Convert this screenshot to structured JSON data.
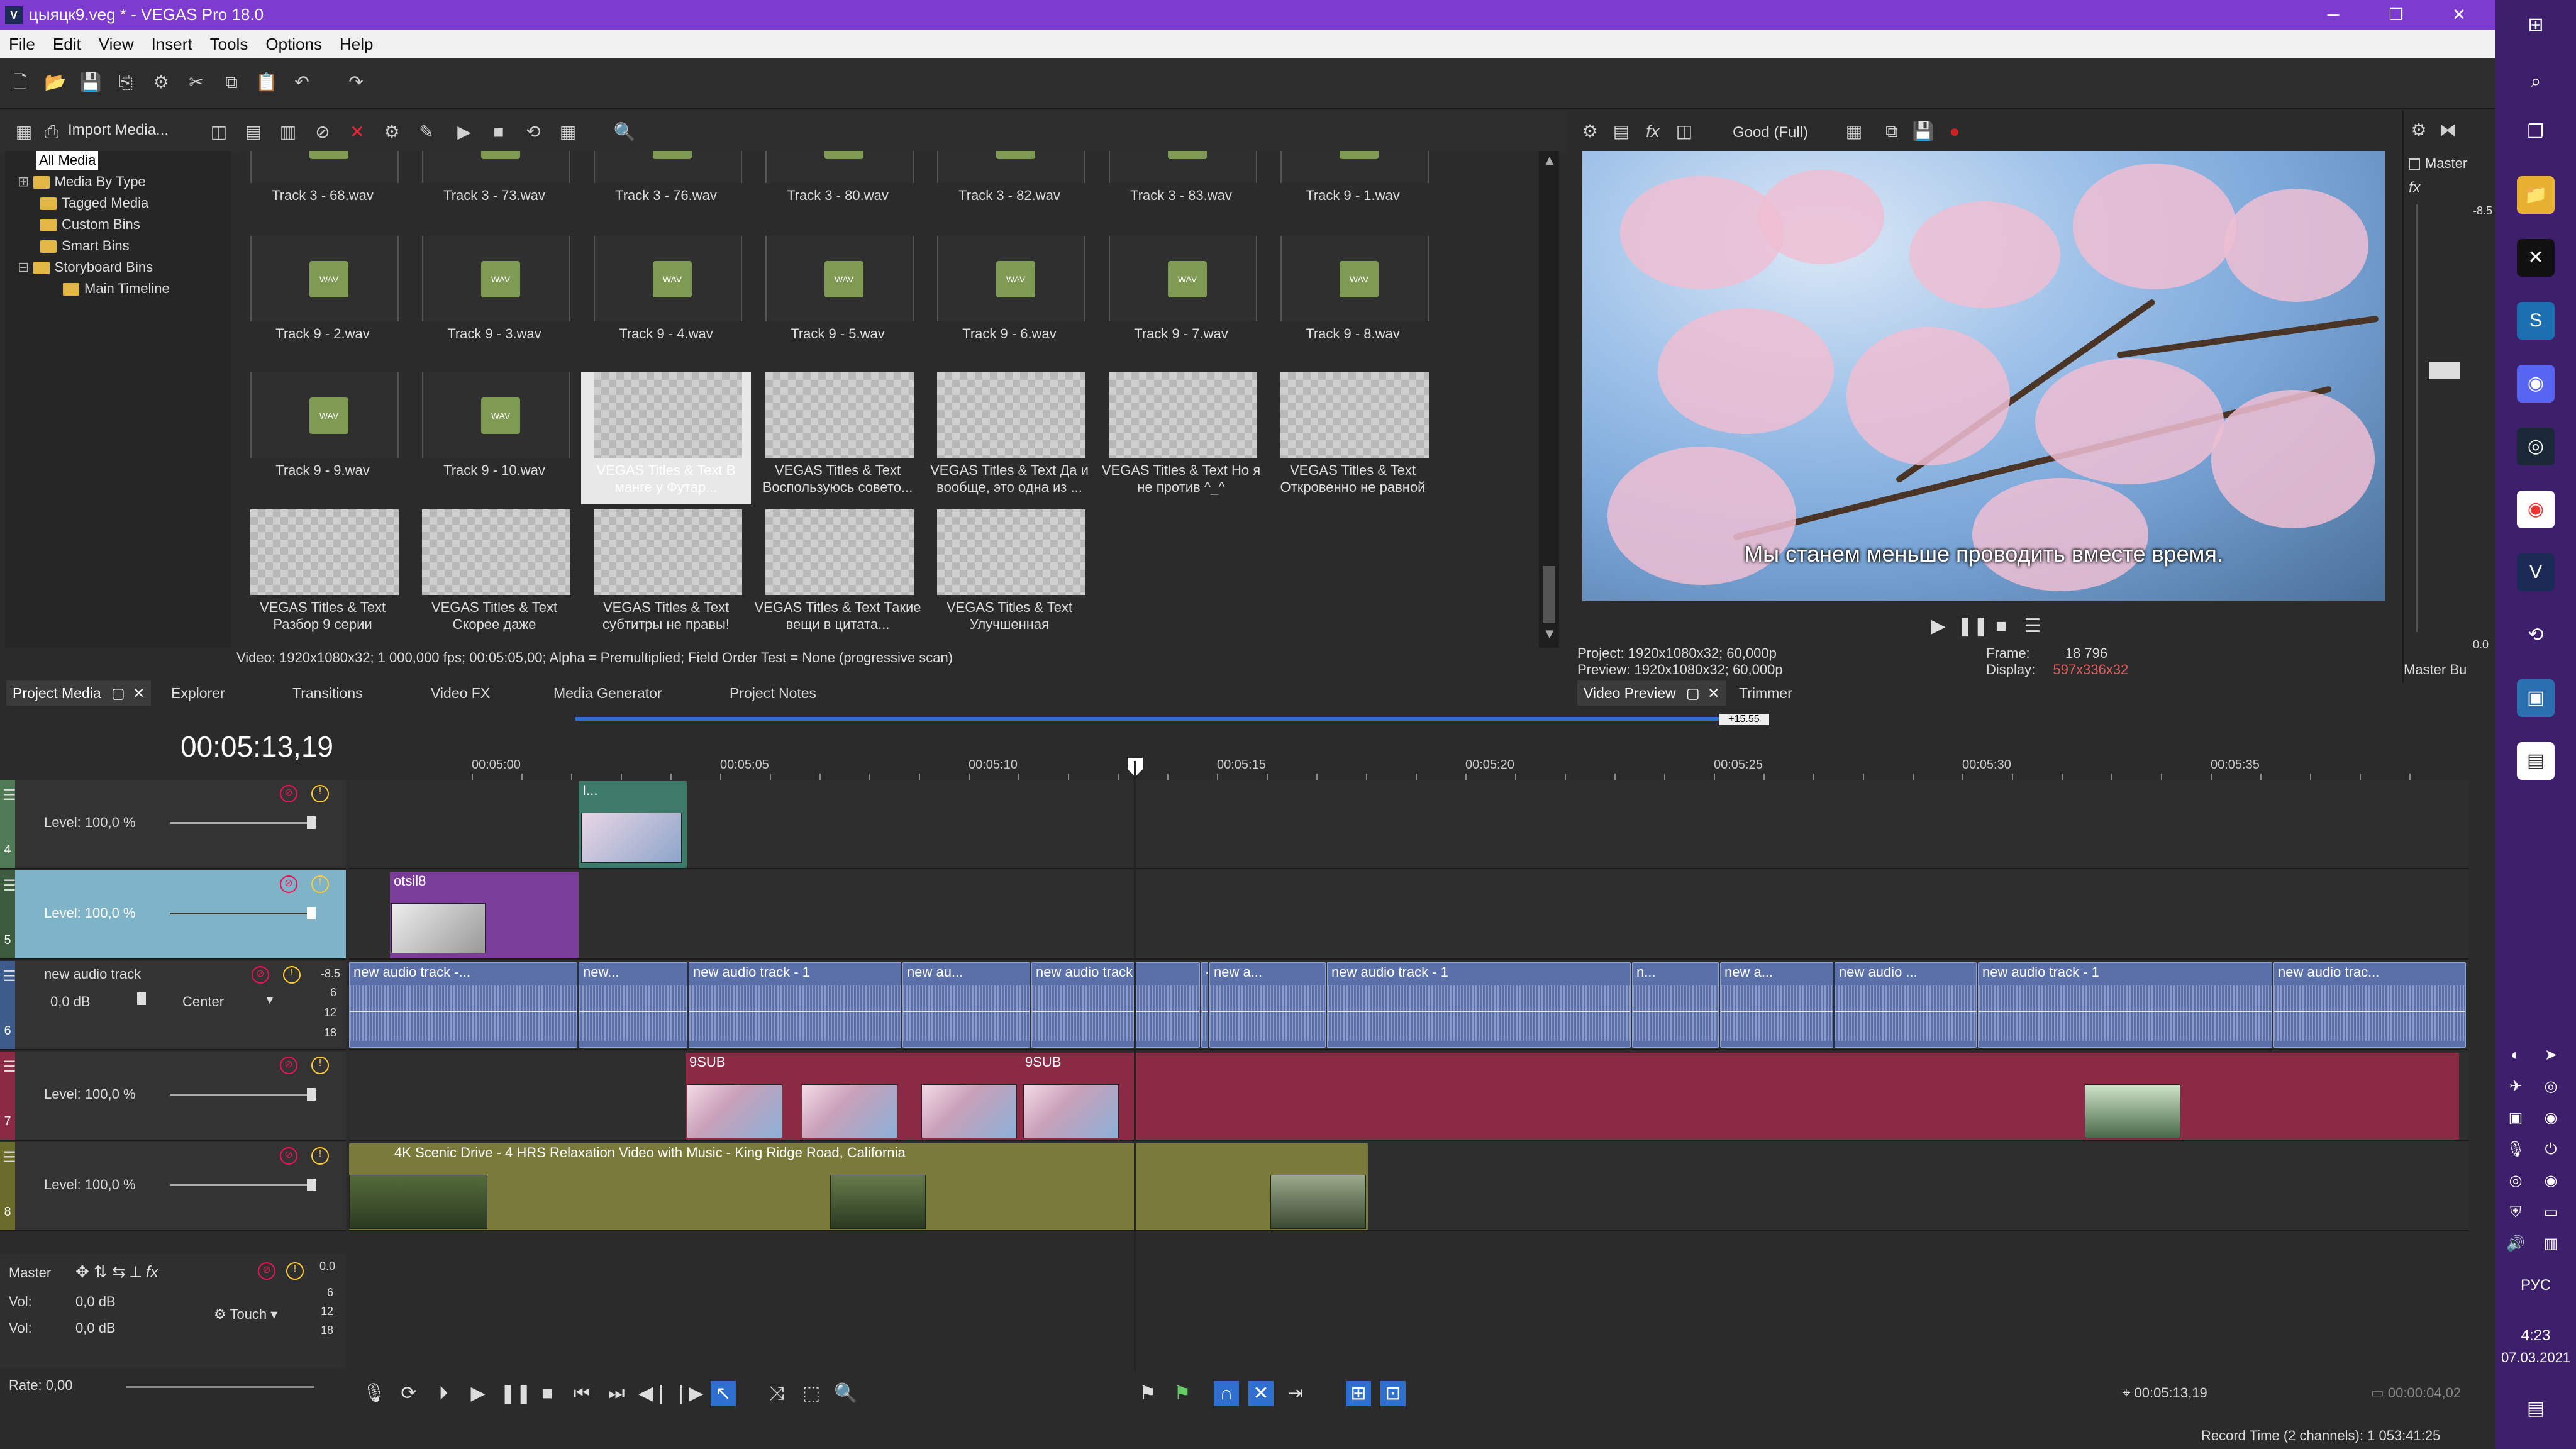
{
  "window": {
    "title": "цыяцк9.veg * - VEGAS Pro 18.0",
    "app_icon": "V"
  },
  "menu": [
    "File",
    "Edit",
    "View",
    "Insert",
    "Tools",
    "Options",
    "Help"
  ],
  "project_media": {
    "import_label": "Import Media...",
    "tree": [
      {
        "label": "All Media",
        "selected": true
      },
      {
        "label": "Media By Type"
      },
      {
        "label": "Tagged Media"
      },
      {
        "label": "Custom Bins"
      },
      {
        "label": "Smart Bins"
      },
      {
        "label": "Storyboard Bins"
      },
      {
        "label": "Main Timeline"
      }
    ],
    "rows": [
      [
        "Track 3 - 68.wav",
        "Track 3 - 73.wav",
        "Track 3 - 76.wav",
        "Track 3 - 80.wav",
        "Track 3 - 82.wav",
        "Track 3 - 83.wav",
        "Track 9 - 1.wav"
      ],
      [
        "Track 9 - 2.wav",
        "Track 9 - 3.wav",
        "Track 9 - 4.wav",
        "Track 9 - 5.wav",
        "Track 9 - 6.wav",
        "Track 9 - 7.wav",
        "Track 9 - 8.wav"
      ],
      [
        "Track 9 - 9.wav",
        "Track 9 - 10.wav",
        "VEGAS Titles & Text В манге у Футар...",
        "VEGAS Titles & Text Воспользуюсь совето...",
        "VEGAS Titles & Text Да и вообще, это одна из ...",
        "VEGAS Titles & Text Но я не против ^_^",
        "VEGAS Titles & Text Откровенно не равной"
      ],
      [
        "VEGAS Titles & Text Разбор 9 серии",
        "VEGAS Titles & Text Скорее даже",
        "VEGAS Titles & Text субтитры не правы!",
        "VEGAS Titles & Text Такие вещи в цитата...",
        "VEGAS Titles & Text Улучшенная"
      ]
    ],
    "wav_badge": "WAV",
    "info": "Video: 1920x1080x32; 1 000,000 fps; 00:05:05,00; Alpha = Premultiplied; Field Order Test = None (progressive scan)",
    "tabs": [
      "Project Media",
      "Explorer",
      "Transitions",
      "Video FX",
      "Media Generator",
      "Project Notes"
    ]
  },
  "preview": {
    "quality": "Good (Full)",
    "subtitle": "Мы станем меньше проводить вместе время.",
    "project_label": "Project:",
    "project_value": "1920x1080x32; 60,000p",
    "preview_label": "Preview:",
    "preview_value": "1920x1080x32; 60,000p",
    "frame_label": "Frame:",
    "frame_value": "18 796",
    "display_label": "Display:",
    "display_value": "597x336x32",
    "tabs": [
      "Video Preview",
      "Trimmer"
    ]
  },
  "mixer": {
    "label": "Master",
    "tab": "Master Bu",
    "db_top": "-8.5",
    "db_bottom": "0.0"
  },
  "timeline": {
    "timecode": "00:05:13,19",
    "loop_marker": "+15.55",
    "ruler": [
      "00:05:00",
      "00:05:05",
      "00:05:10",
      "00:05:15",
      "00:05:20",
      "00:05:25",
      "00:05:30",
      "00:05:35"
    ],
    "tracks": [
      {
        "num": "4",
        "level": "Level: 100,0 %"
      },
      {
        "num": "5",
        "level": "Level: 100,0 %"
      },
      {
        "num": "6",
        "name": "new audio track",
        "vol": "0,0 dB",
        "pan": "Center",
        "meter_top": "-8.5"
      },
      {
        "num": "7",
        "level": "Level: 100,0 %"
      },
      {
        "num": "8",
        "level": "Level: 100,0 %"
      }
    ],
    "events": {
      "t4": "I...",
      "t5": "otsil8",
      "audio": [
        "new audio track -...",
        "new...",
        "new audio track - 1",
        "new au...",
        "new audio track",
        "- 1",
        "new a...",
        "new audio track - 1",
        "n...",
        "new a...",
        "new audio ...",
        "new audio track - 1",
        "new audio trac..."
      ],
      "t7": [
        "9SUB",
        "9SUB"
      ],
      "t8": "4K Scenic Drive - 4 HRS Relaxation Video with Music - King Ridge Road, California"
    },
    "meter_labels": [
      "6",
      "12",
      "18"
    ]
  },
  "master": {
    "label": "Master",
    "vol1_label": "Vol:",
    "vol1": "0,0 dB",
    "vol2_label": "Vol:",
    "vol2": "0,0 dB",
    "touch": "Touch",
    "rate": "Rate: 0,00",
    "db0": "0.0",
    "db6": "6",
    "db12": "12",
    "db18": "18"
  },
  "transport": {
    "time": "00:05:13,19",
    "time2": "00:00:04,02"
  },
  "status": {
    "record": "Record Time (2 channels): 1 053:41:25"
  },
  "taskbar": {
    "time": "4:23",
    "date": "07.03.2021",
    "lang": "РУС"
  },
  "colors": {
    "titlebar": "#7d3bd0",
    "taskbar": "#3d1f6b",
    "audio_event": "#5b6fa8",
    "video_event_red": "#8a2a45",
    "video_event_olive": "#7a7a3a",
    "track_header_5": "#7fb3c8"
  }
}
